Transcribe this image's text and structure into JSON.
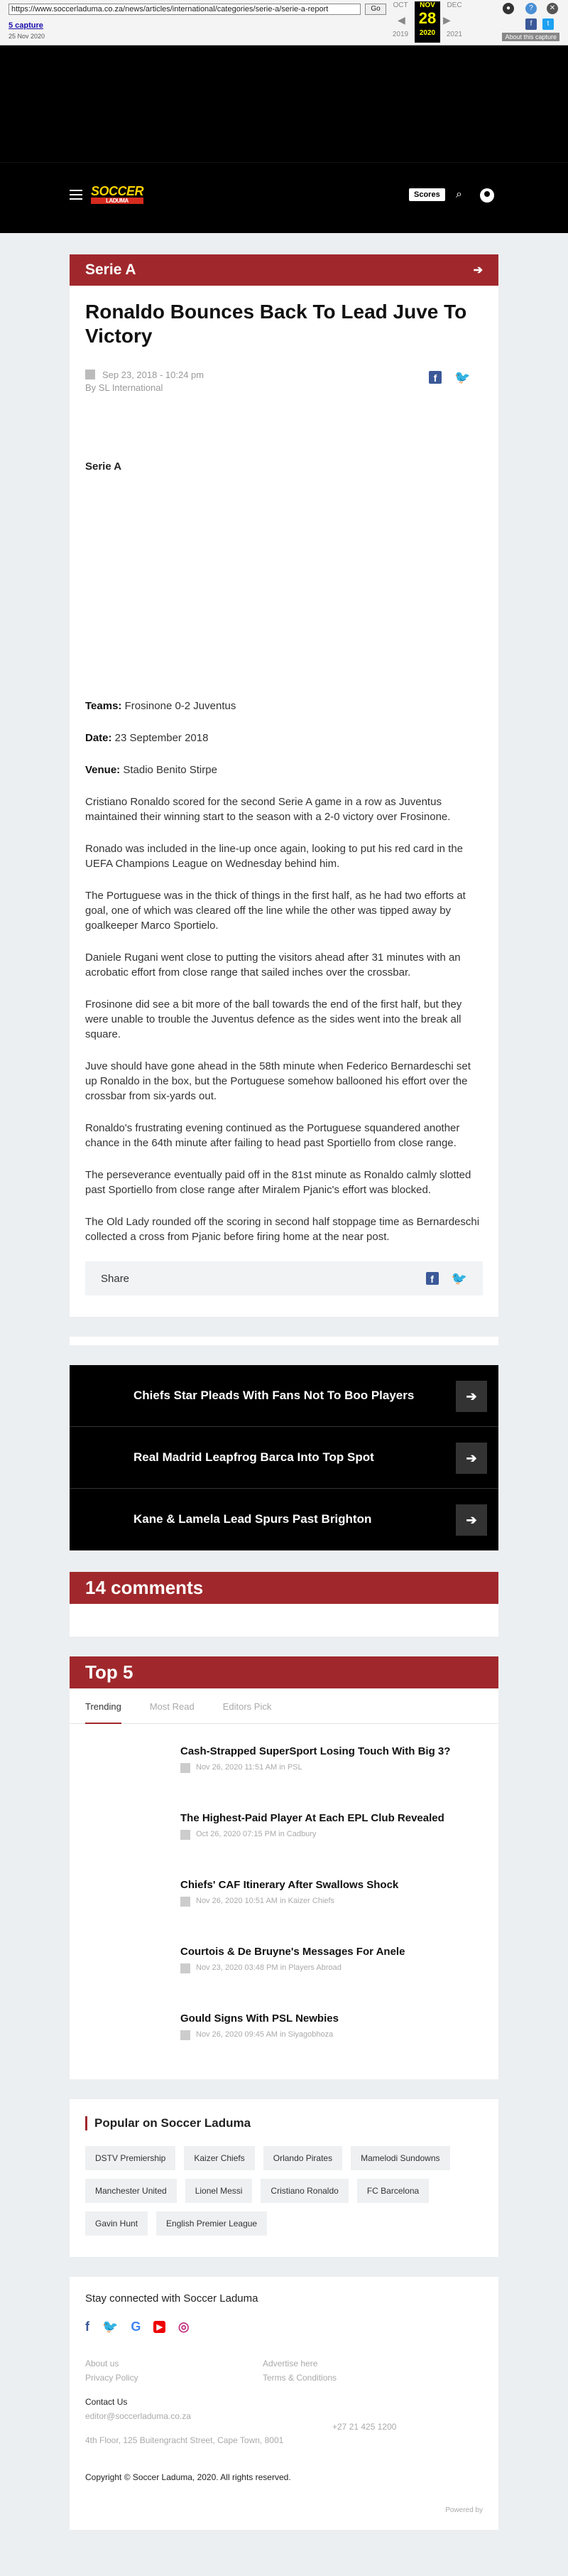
{
  "wayback": {
    "url": "https://www.soccerladuma.co.za/news/articles/international/categories/serie-a/serie-a-report",
    "go": "Go",
    "capture_label": "5 capture",
    "capture_date": "25 Nov 2020",
    "prev_month": "OCT",
    "prev_year": "2019",
    "cur_month": "NOV",
    "cur_day": "28",
    "cur_year": "2020",
    "next_month": "DEC",
    "next_year": "2021",
    "about": "About this capture"
  },
  "header": {
    "logo": "SOCCER",
    "logo_sub": "LADUMA",
    "scores": "Scores"
  },
  "article": {
    "section": "Serie A",
    "title": "Ronaldo Bounces Back To Lead Juve To Victory",
    "date": "Sep 23, 2018 - 10:24 pm",
    "byline": "By SL International",
    "sublabel": "Serie A",
    "teams_label": "Teams:",
    "teams": " Frosinone 0-2 Juventus",
    "date_label": "Date:",
    "date_val": " 23 September 2018",
    "venue_label": "Venue:",
    "venue": " Stadio Benito Stirpe",
    "paragraphs": [
      "Cristiano Ronaldo scored for the second Serie A game in a row as Juventus maintained their winning start to the season with a 2-0 victory over Frosinone.",
      "Ronado was included in the line-up once again, looking to put his red card in the UEFA Champions League on Wednesday behind him.",
      "The Portuguese was in the thick of things in the first half, as he had two efforts at goal, one of which was cleared off the line while the other was tipped away by goalkeeper Marco Sportielo.",
      "Daniele Rugani went close to putting the visitors ahead after 31 minutes with an acrobatic effort from close range that sailed inches over the crossbar.",
      "Frosinone did see a bit more of the ball towards the end of the first half, but they were unable to trouble the Juventus defence as the sides went into the break all square.",
      "Juve should have gone ahead in the 58th minute when Federico Bernardeschi set up Ronaldo in the box, but the Portuguese somehow ballooned his effort over the crossbar from six-yards out.",
      "Ronaldo's frustrating evening continued as the Portuguese squandered another chance in the 64th minute after failing to head past Sportiello from close range.",
      "The perseverance eventually paid off in the 81st minute as Ronaldo calmly slotted past Sportiello from close range after Miralem Pjanic's effort was blocked.",
      "The Old Lady rounded off the scoring in second half stoppage time as Bernardeschi collected a cross from Pjanic before firing home at the near post."
    ],
    "share": "Share"
  },
  "related": [
    "Chiefs Star Pleads With Fans Not To Boo Players",
    "Real Madrid Leapfrog Barca Into Top Spot",
    "Kane & Lamela Lead Spurs Past Brighton"
  ],
  "comments": "14 comments",
  "top5": {
    "title": "Top 5",
    "tabs": [
      "Trending",
      "Most Read",
      "Editors Pick"
    ],
    "items": [
      {
        "h": "Cash-Strapped SuperSport Losing Touch With Big 3?",
        "m": "Nov 26, 2020 11:51 AM in PSL"
      },
      {
        "h": "The Highest-Paid Player At Each EPL Club Revealed",
        "m": "Oct 26, 2020 07:15 PM in Cadbury"
      },
      {
        "h": "Chiefs' CAF Itinerary After Swallows Shock",
        "m": "Nov 26, 2020 10:51 AM in Kaizer Chiefs"
      },
      {
        "h": "Courtois & De Bruyne's Messages For Anele",
        "m": "Nov 23, 2020 03:48 PM in Players Abroad"
      },
      {
        "h": "Gould Signs With PSL Newbies",
        "m": "Nov 26, 2020 09:45 AM in Siyagobhoza"
      }
    ]
  },
  "popular": {
    "title": "Popular on Soccer Laduma",
    "chips": [
      "DSTV Premiership",
      "Kaizer Chiefs",
      "Orlando Pirates",
      "Mamelodi Sundowns",
      "Manchester United",
      "Lionel Messi",
      "Cristiano Ronaldo",
      "FC Barcelona",
      "Gavin Hunt",
      "English Premier League"
    ]
  },
  "footer": {
    "stay": "Stay connected with Soccer Laduma",
    "about": "About us",
    "advertise": "Advertise here",
    "privacy": "Privacy Policy",
    "terms": "Terms & Conditions",
    "contact": "Contact Us",
    "email": "editor@soccerladuma.co.za",
    "phone": "+27 21 425 1200",
    "address": "4th Floor, 125 Buitengracht Street, Cape Town, 8001",
    "copyright": "Copyright © Soccer Laduma, 2020. All rights reserved.",
    "powered": "Powered by"
  }
}
